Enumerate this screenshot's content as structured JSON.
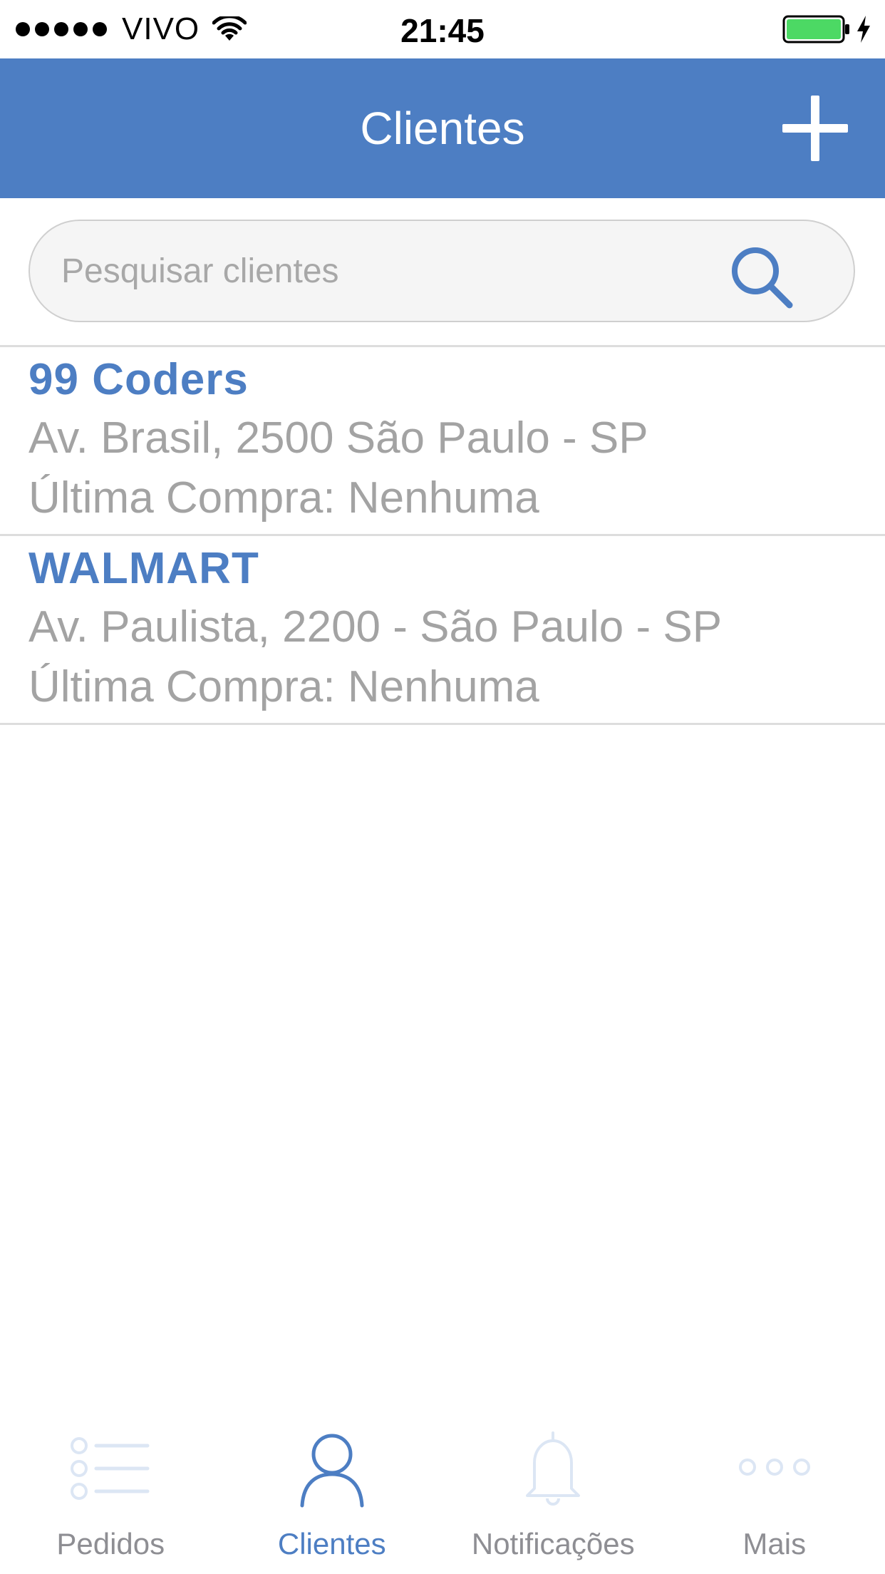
{
  "status_bar": {
    "carrier": "VIVO",
    "time": "21:45",
    "signal_icon": "signal-dots-icon",
    "wifi_icon": "wifi-icon",
    "battery_icon": "battery-charging-icon",
    "battery_color": "#4cd964"
  },
  "nav": {
    "title": "Clientes",
    "add_icon": "plus-icon",
    "background": "#4d7ec3"
  },
  "search": {
    "placeholder": "Pesquisar clientes",
    "value": "",
    "icon": "search-icon"
  },
  "clients": [
    {
      "name": "99 Coders",
      "address": "Av. Brasil, 2500 São Paulo - SP",
      "last_purchase": "Última Compra: Nenhuma"
    },
    {
      "name": "WALMART",
      "address": "Av. Paulista, 2200 - São Paulo - SP",
      "last_purchase": "Última Compra: Nenhuma"
    }
  ],
  "tabs": [
    {
      "label": "Pedidos",
      "icon": "list-icon",
      "active": false
    },
    {
      "label": "Clientes",
      "icon": "person-icon",
      "active": true
    },
    {
      "label": "Notificações",
      "icon": "bell-icon",
      "active": false
    },
    {
      "label": "Mais",
      "icon": "more-dots-icon",
      "active": false
    }
  ],
  "colors": {
    "accent": "#4d7ec3",
    "secondary_text": "#a3a3a3",
    "inactive_tab_icon": "#dce6f4"
  }
}
